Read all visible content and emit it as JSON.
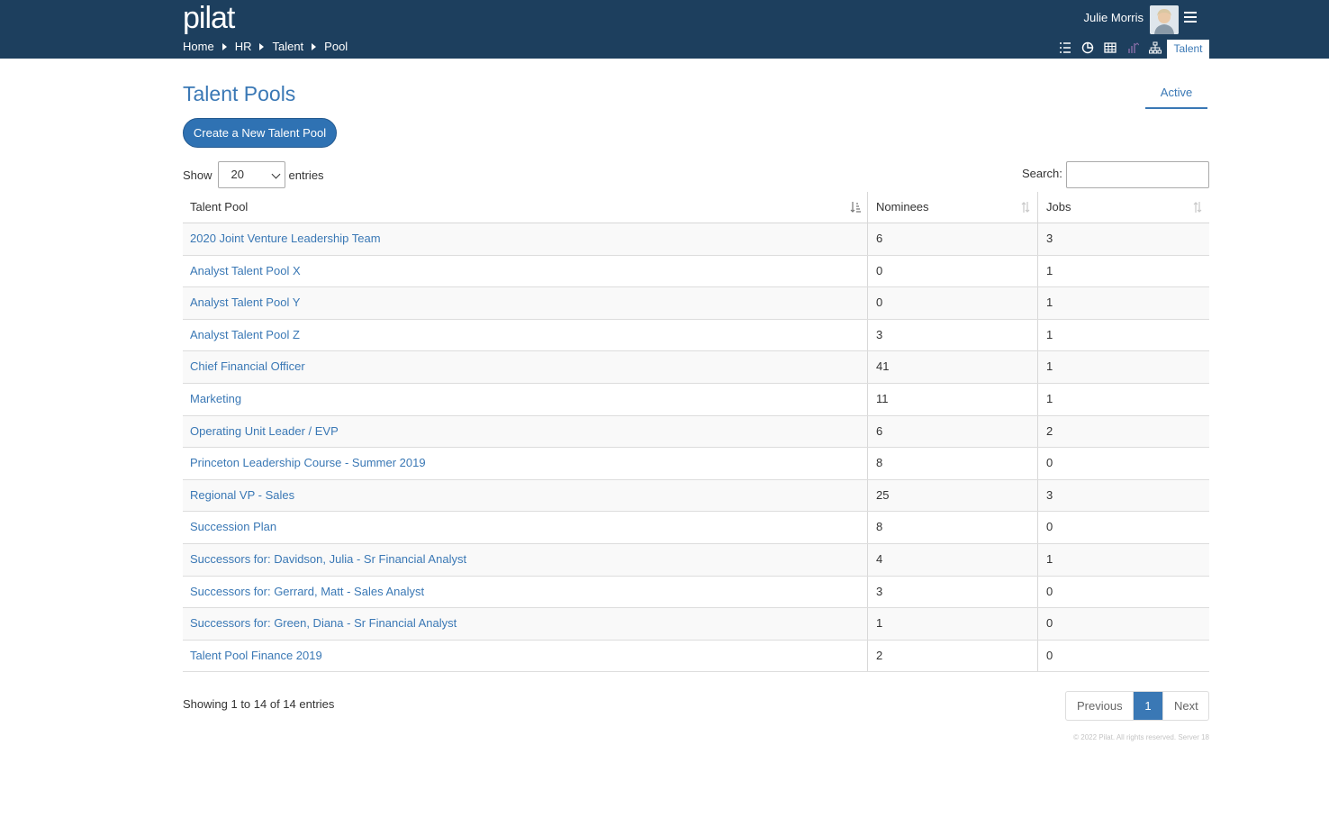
{
  "header": {
    "logo": "pilat",
    "breadcrumb": [
      "Home",
      "HR",
      "Talent",
      "Pool"
    ],
    "user_name": "Julie Morris",
    "nav_icons": [
      "checklist-icon",
      "pie-chart-icon",
      "grid-icon",
      "sort-chart-icon",
      "org-chart-icon"
    ],
    "active_tab": "Talent"
  },
  "page": {
    "title": "Talent Pools",
    "status_tab": "Active",
    "create_button": "Create a New Talent Pool"
  },
  "controls": {
    "show_label": "Show",
    "entries_value": "20",
    "entries_label": "entries",
    "search_label": "Search:",
    "search_value": ""
  },
  "table": {
    "columns": [
      "Talent Pool",
      "Nominees",
      "Jobs"
    ],
    "rows": [
      {
        "pool": "2020 Joint Venture Leadership Team",
        "nominees": "6",
        "jobs": "3"
      },
      {
        "pool": "Analyst Talent Pool X",
        "nominees": "0",
        "jobs": "1"
      },
      {
        "pool": "Analyst Talent Pool Y",
        "nominees": "0",
        "jobs": "1"
      },
      {
        "pool": "Analyst Talent Pool Z",
        "nominees": "3",
        "jobs": "1"
      },
      {
        "pool": "Chief Financial Officer",
        "nominees": "41",
        "jobs": "1"
      },
      {
        "pool": "Marketing",
        "nominees": "11",
        "jobs": "1"
      },
      {
        "pool": "Operating Unit Leader / EVP",
        "nominees": "6",
        "jobs": "2"
      },
      {
        "pool": "Princeton Leadership Course - Summer 2019",
        "nominees": "8",
        "jobs": "0"
      },
      {
        "pool": "Regional VP - Sales",
        "nominees": "25",
        "jobs": "3"
      },
      {
        "pool": "Succession Plan",
        "nominees": "8",
        "jobs": "0"
      },
      {
        "pool": "Successors for: Davidson, Julia - Sr Financial Analyst",
        "nominees": "4",
        "jobs": "1"
      },
      {
        "pool": "Successors for: Gerrard, Matt - Sales Analyst",
        "nominees": "3",
        "jobs": "0"
      },
      {
        "pool": "Successors for: Green, Diana - Sr Financial Analyst",
        "nominees": "1",
        "jobs": "0"
      },
      {
        "pool": "Talent Pool Finance 2019",
        "nominees": "2",
        "jobs": "0"
      }
    ]
  },
  "footer": {
    "info": "Showing 1 to 14 of 14 entries",
    "pager": {
      "previous": "Previous",
      "current": "1",
      "next": "Next"
    },
    "copyright": "© 2022 Pilat. All rights reserved. Server 18"
  },
  "colors": {
    "header_bg": "#1d3f5e",
    "accent": "#3a78b5",
    "button": "#2f72b3"
  }
}
